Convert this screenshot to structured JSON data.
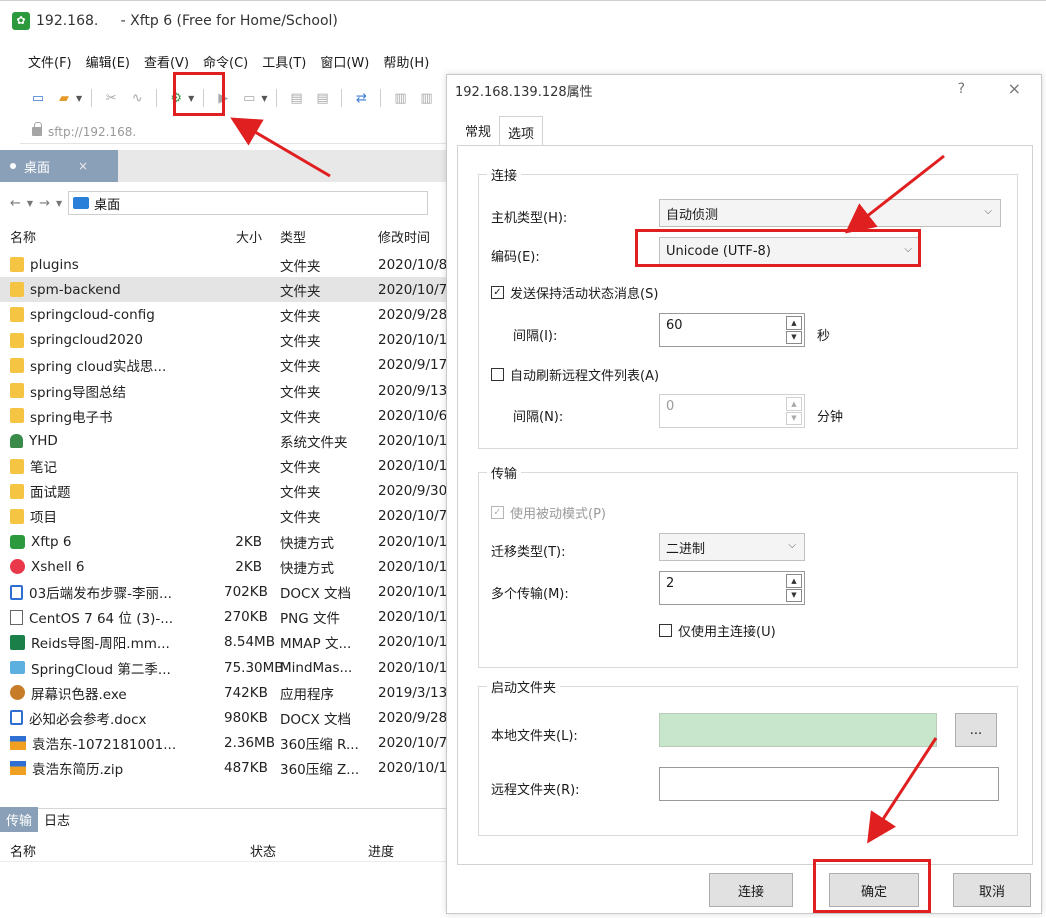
{
  "window": {
    "app_icon": "xftp-icon",
    "title": "192.168.     - Xftp 6 (Free for Home/School)"
  },
  "menu": [
    "文件(F)",
    "编辑(E)",
    "查看(V)",
    "命令(C)",
    "工具(T)",
    "窗口(W)",
    "帮助(H)"
  ],
  "address": {
    "text": "sftp://192.168."
  },
  "session_tab": {
    "label": "桌面",
    "close": "×"
  },
  "path": {
    "current": "桌面"
  },
  "file_columns": {
    "name": "名称",
    "size": "大小",
    "type": "类型",
    "modified": "修改时间"
  },
  "files": [
    {
      "icon": "folder",
      "name": "plugins",
      "size": "",
      "type": "文件夹",
      "modified": "2020/10/8"
    },
    {
      "icon": "folder",
      "name": "spm-backend",
      "size": "",
      "type": "文件夹",
      "modified": "2020/10/7",
      "selected": true
    },
    {
      "icon": "folder",
      "name": "springcloud-config",
      "size": "",
      "type": "文件夹",
      "modified": "2020/9/28"
    },
    {
      "icon": "folder",
      "name": "springcloud2020",
      "size": "",
      "type": "文件夹",
      "modified": "2020/10/1"
    },
    {
      "icon": "folder",
      "name": "spring cloud实战思...",
      "size": "",
      "type": "文件夹",
      "modified": "2020/9/17"
    },
    {
      "icon": "folder",
      "name": "spring导图总结",
      "size": "",
      "type": "文件夹",
      "modified": "2020/9/13"
    },
    {
      "icon": "folder",
      "name": "spring电子书",
      "size": "",
      "type": "文件夹",
      "modified": "2020/10/6"
    },
    {
      "icon": "user",
      "name": "YHD",
      "size": "",
      "type": "系统文件夹",
      "modified": "2020/10/1"
    },
    {
      "icon": "folder",
      "name": "笔记",
      "size": "",
      "type": "文件夹",
      "modified": "2020/10/1"
    },
    {
      "icon": "folder",
      "name": "面试题",
      "size": "",
      "type": "文件夹",
      "modified": "2020/9/30"
    },
    {
      "icon": "folder",
      "name": "项目",
      "size": "",
      "type": "文件夹",
      "modified": "2020/10/7"
    },
    {
      "icon": "xftp",
      "name": "Xftp 6",
      "size": "2KB",
      "type": "快捷方式",
      "modified": "2020/10/1"
    },
    {
      "icon": "xshell",
      "name": "Xshell 6",
      "size": "2KB",
      "type": "快捷方式",
      "modified": "2020/10/1"
    },
    {
      "icon": "doc",
      "name": "03后端发布步骤-李丽...",
      "size": "702KB",
      "type": "DOCX 文档",
      "modified": "2020/10/1"
    },
    {
      "icon": "png",
      "name": "CentOS 7 64 位 (3)-...",
      "size": "270KB",
      "type": "PNG 文件",
      "modified": "2020/10/1"
    },
    {
      "icon": "mmap",
      "name": "Reids导图-周阳.mm...",
      "size": "8.54MB",
      "type": "MMAP 文...",
      "modified": "2020/10/1"
    },
    {
      "icon": "mind",
      "name": "SpringCloud 第二季...",
      "size": "75.30MB",
      "type": "MindMas...",
      "modified": "2020/10/1"
    },
    {
      "icon": "exe",
      "name": "屏幕识色器.exe",
      "size": "742KB",
      "type": "应用程序",
      "modified": "2019/3/13"
    },
    {
      "icon": "doc",
      "name": "必知必会参考.docx",
      "size": "980KB",
      "type": "DOCX 文档",
      "modified": "2020/9/28"
    },
    {
      "icon": "zip",
      "name": "袁浩东-1072181001...",
      "size": "2.36MB",
      "type": "360压缩 R...",
      "modified": "2020/10/7"
    },
    {
      "icon": "zip",
      "name": "袁浩东简历.zip",
      "size": "487KB",
      "type": "360压缩 Z...",
      "modified": "2020/10/1"
    }
  ],
  "transfer": {
    "tabs": [
      "传输",
      "日志"
    ],
    "columns": {
      "name": "名称",
      "status": "状态",
      "progress": "进度"
    }
  },
  "dialog": {
    "title": "192.168.139.128属性",
    "help": "?",
    "close": "×",
    "tabs": [
      "常规",
      "选项"
    ],
    "active_tab": "选项",
    "connection": {
      "group": "连接",
      "host_type_label": "主机类型(H):",
      "host_type_value": "自动侦测",
      "encoding_label": "编码(E):",
      "encoding_value": "Unicode (UTF-8)",
      "keepalive_label": "发送保持活动状态消息(S)",
      "keepalive_checked": true,
      "interval_label": "间隔(I):",
      "interval_value": "60",
      "interval_unit": "秒",
      "auto_refresh_label": "自动刷新远程文件列表(A)",
      "auto_refresh_checked": false,
      "refresh_interval_label": "间隔(N):",
      "refresh_interval_value": "0",
      "refresh_interval_unit": "分钟"
    },
    "transfer": {
      "group": "传输",
      "passive_label": "使用被动模式(P)",
      "passive_checked": true,
      "transfer_type_label": "迁移类型(T):",
      "transfer_type_value": "二进制",
      "multi_label": "多个传输(M):",
      "multi_value": "2",
      "main_only_label": "仅使用主连接(U)",
      "main_only_checked": false
    },
    "startup": {
      "group": "启动文件夹",
      "local_label": "本地文件夹(L):",
      "local_value": "",
      "browse": "...",
      "remote_label": "远程文件夹(R):",
      "remote_value": ""
    },
    "buttons": {
      "connect": "连接",
      "ok": "确定",
      "cancel": "取消"
    }
  },
  "colors": {
    "annotation_red": "#e02020",
    "tab_active": "#8aa0b8",
    "local_folder_fill": "#c8e6cb"
  }
}
